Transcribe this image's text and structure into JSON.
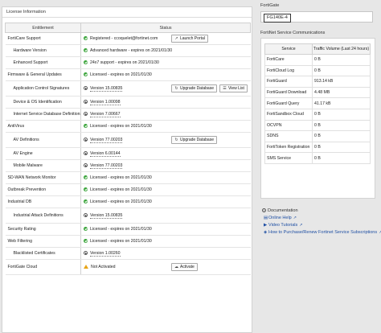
{
  "license_panel": {
    "title": "License Information",
    "headers": {
      "entitlement": "Entitlement",
      "status": "Status"
    },
    "rows": [
      {
        "entitlement": "FortiCare Support",
        "sub": false,
        "status_type": "ok",
        "status": "Registered - ccoquelet@fortinet.com",
        "buttons": [
          {
            "label": "Launch Portal",
            "icon": "external-link-icon"
          }
        ]
      },
      {
        "entitlement": "Hardware Version",
        "sub": true,
        "status_type": "ok",
        "status": "Advanced hardware - expires on 2021/01/30",
        "buttons": []
      },
      {
        "entitlement": "Enhanced Support",
        "sub": true,
        "status_type": "ok",
        "status": "24x7 support - expires on 2021/01/30",
        "buttons": []
      },
      {
        "entitlement": "Firmware & General Updates",
        "sub": false,
        "status_type": "ok",
        "status": "Licensed - expires on 2021/01/30",
        "buttons": []
      },
      {
        "entitlement": "Application Control Signatures",
        "sub": true,
        "status_type": "version",
        "status": "Version 15.00835",
        "tall": true,
        "buttons": [
          {
            "label": "Upgrade Database",
            "icon": "upgrade-icon"
          },
          {
            "label": "View List",
            "icon": "list-icon"
          }
        ]
      },
      {
        "entitlement": "Device & OS Identification",
        "sub": true,
        "status_type": "version",
        "status": "Version 1.00098",
        "buttons": []
      },
      {
        "entitlement": "Internet Service Database Definitions",
        "sub": true,
        "status_type": "version",
        "status": "Version 7.00667",
        "buttons": []
      },
      {
        "entitlement": "AntiVirus",
        "sub": false,
        "status_type": "ok",
        "status": "Licensed - expires on 2021/01/30",
        "buttons": []
      },
      {
        "entitlement": "AV Definitions",
        "sub": true,
        "status_type": "version",
        "status": "Version 77.00203",
        "tall": true,
        "buttons": [
          {
            "label": "Upgrade Database",
            "icon": "upgrade-icon"
          }
        ]
      },
      {
        "entitlement": "AV Engine",
        "sub": true,
        "status_type": "version",
        "status": "Version 6.00144",
        "buttons": []
      },
      {
        "entitlement": "Mobile Malware",
        "sub": true,
        "status_type": "version",
        "status": "Version 77.00203",
        "buttons": []
      },
      {
        "entitlement": "SD-WAN Network Monitor",
        "sub": false,
        "status_type": "ok",
        "status": "Licensed - expires on 2021/01/30",
        "buttons": []
      },
      {
        "entitlement": "Outbreak Prevention",
        "sub": false,
        "status_type": "ok",
        "status": "Licensed - expires on 2021/01/30",
        "buttons": []
      },
      {
        "entitlement": "Industrial DB",
        "sub": false,
        "status_type": "ok",
        "status": "Licensed - expires on 2021/01/30",
        "buttons": []
      },
      {
        "entitlement": "Industrial Attack Definitions",
        "sub": true,
        "status_type": "version",
        "status": "Version 15.00835",
        "tall": true,
        "buttons": []
      },
      {
        "entitlement": "Security Rating",
        "sub": false,
        "status_type": "ok",
        "status": "Licensed - expires on 2021/01/30",
        "buttons": []
      },
      {
        "entitlement": "Web Filtering",
        "sub": false,
        "status_type": "ok",
        "status": "Licensed - expires on 2021/01/30",
        "buttons": []
      },
      {
        "entitlement": "Blacklisted Certificates",
        "sub": true,
        "status_type": "version",
        "status": "Version 1.00260",
        "buttons": []
      },
      {
        "entitlement": "FortiGate Cloud",
        "sub": false,
        "status_type": "warn",
        "status": "Not Activated",
        "tall": true,
        "buttons": [
          {
            "label": "Activate",
            "icon": "activate-icon"
          }
        ]
      }
    ]
  },
  "right_panel": {
    "device_label": "FortiGate",
    "device_model": "FG140E-4",
    "services_title": "FortiNet Service Communications",
    "services_headers": {
      "service": "Service",
      "volume": "Traffic Volume (Last 24 hours)"
    },
    "services": [
      {
        "service": "FortiCare",
        "volume": "0 B"
      },
      {
        "service": "FortiCloud Log",
        "volume": "0 B"
      },
      {
        "service": "FortiGuard",
        "volume": "913.14 kB"
      },
      {
        "service": "FortiGuard Download",
        "volume": "4.48 MB"
      },
      {
        "service": "FortiGuard Query",
        "volume": "41.17 kB"
      },
      {
        "service": "FortiSandbox Cloud",
        "volume": "0 B"
      },
      {
        "service": "OCVPN",
        "volume": "0 B"
      },
      {
        "service": "SDNS",
        "volume": "0 B"
      },
      {
        "service": "FortiToken Registration",
        "volume": "0 B"
      },
      {
        "service": "SMS Service",
        "volume": "0 B"
      }
    ],
    "documentation_title": "Documentation",
    "doc_links": [
      {
        "label": "Online Help",
        "icon": "book-icon"
      },
      {
        "label": "Video Tutorials",
        "icon": "video-icon"
      },
      {
        "label": "How to Purchase/Renew Fortinet Service Subscriptions",
        "icon": "link-icon"
      }
    ]
  }
}
